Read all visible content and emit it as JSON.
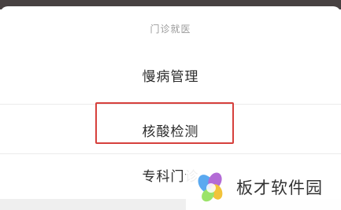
{
  "sheet": {
    "title": "门诊就医",
    "options": [
      {
        "label": "慢病管理"
      },
      {
        "label": "核酸检测"
      },
      {
        "label": "专科门诊"
      }
    ]
  },
  "highlight": {
    "color": "#d6403c"
  },
  "watermark": {
    "brand": "板才软件园",
    "logo": "colorful-petal-logo"
  },
  "colors": {
    "overlay": "#474141",
    "accent": "#d6403c"
  }
}
